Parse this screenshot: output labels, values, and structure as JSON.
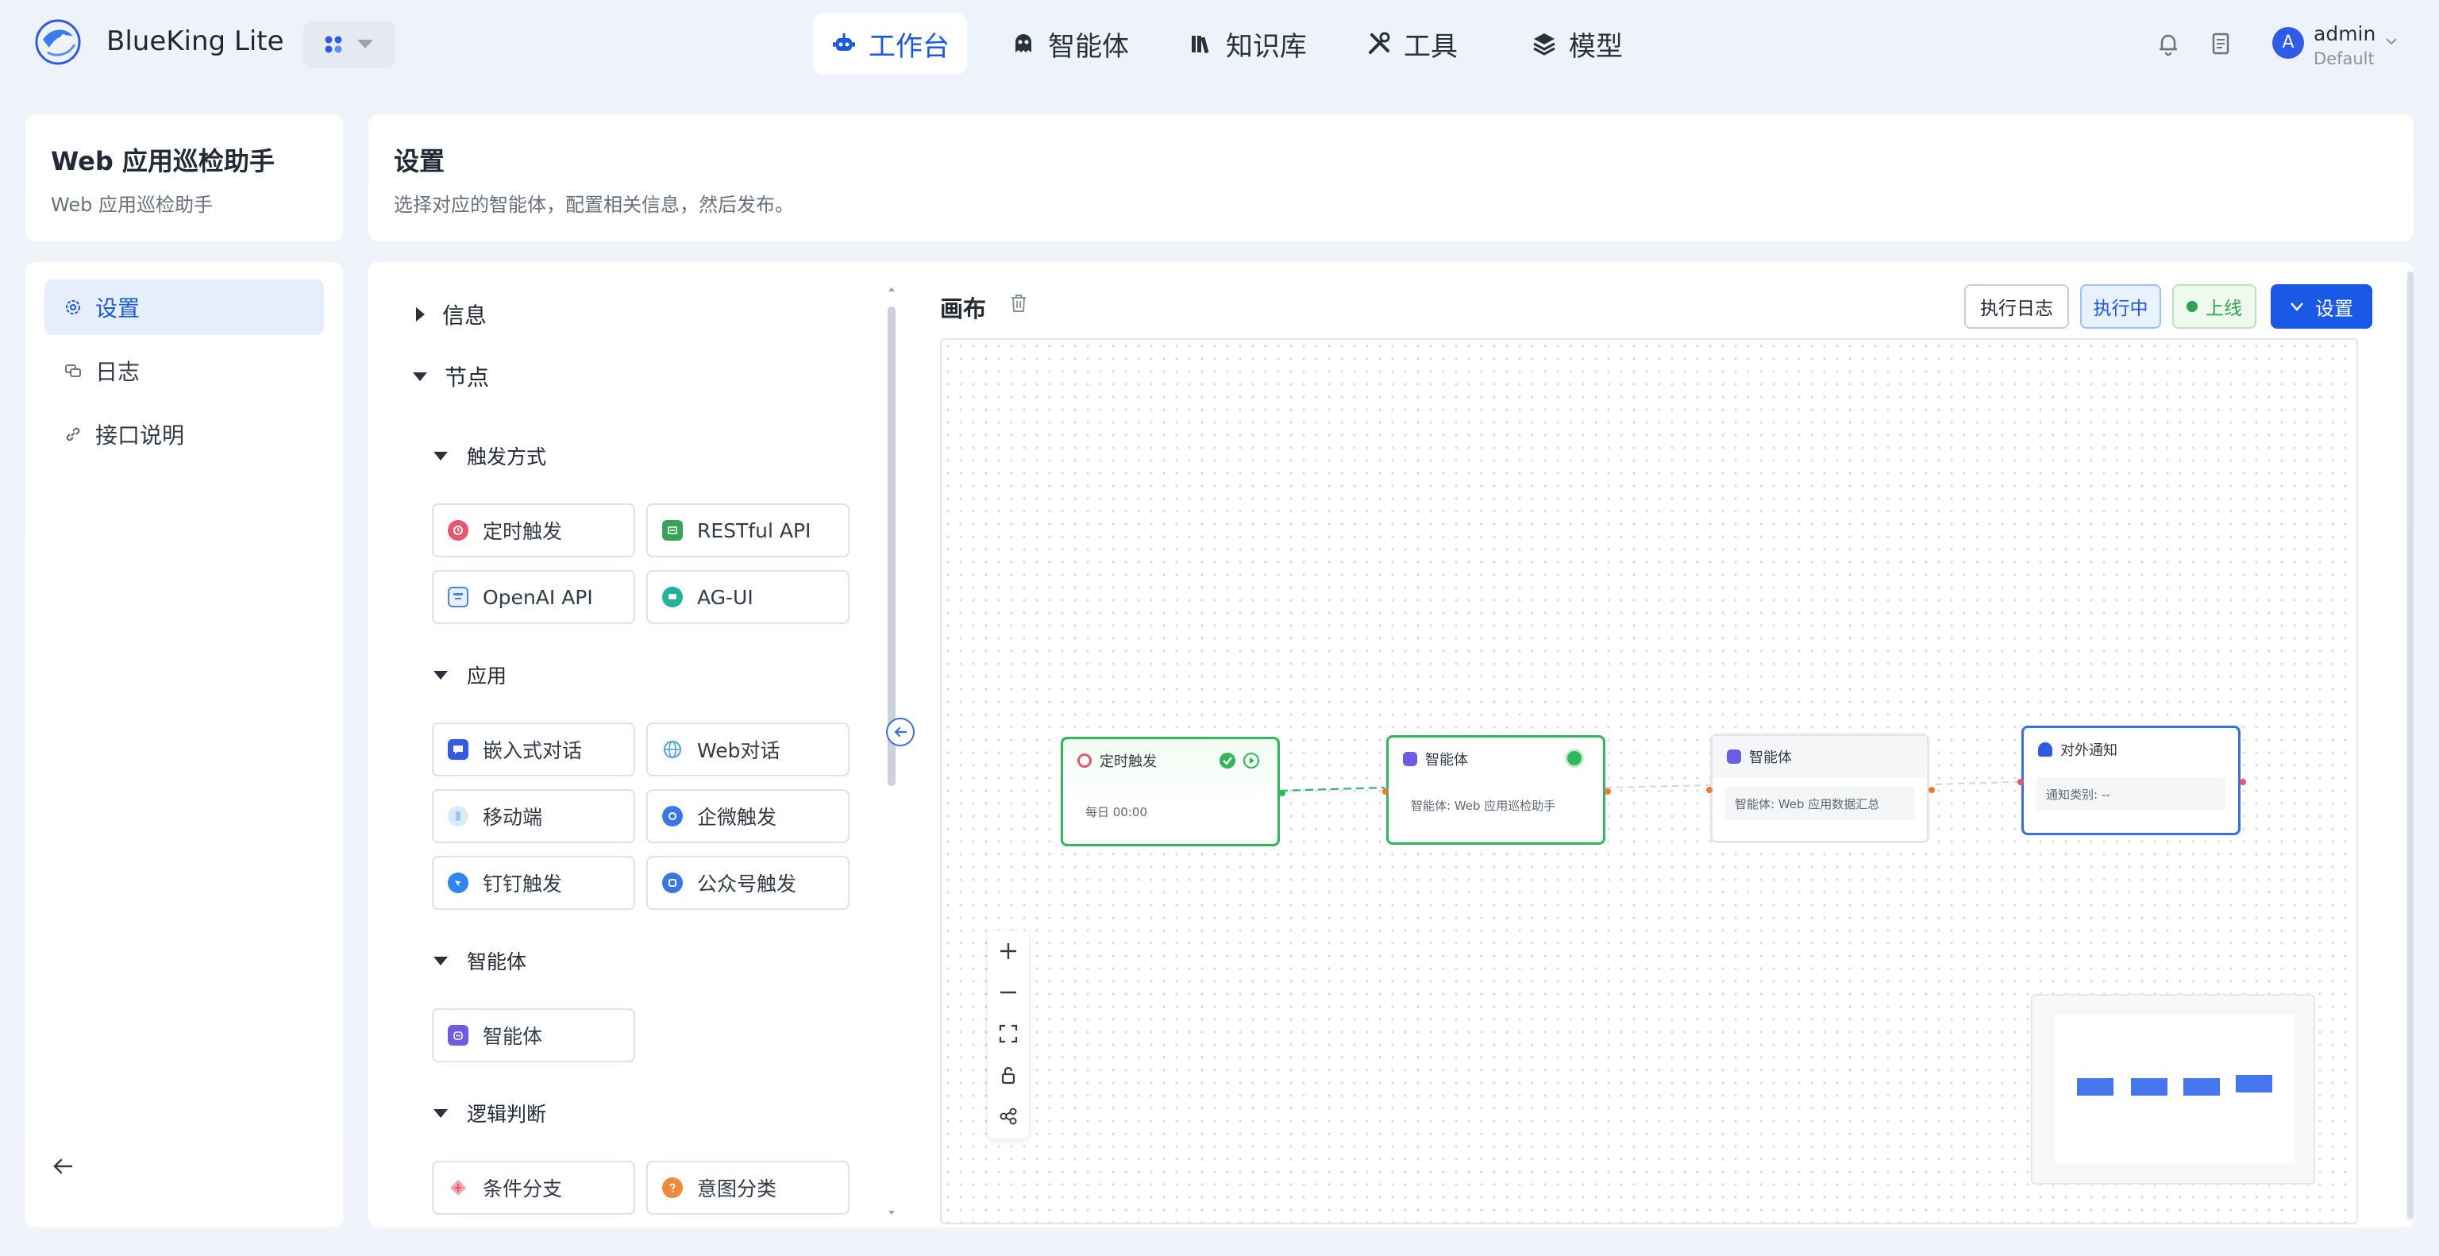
{
  "header": {
    "brand": "BlueKing Lite",
    "nav": [
      {
        "label": "工作台",
        "icon": "robot-icon",
        "active": true
      },
      {
        "label": "智能体",
        "icon": "agent-icon",
        "active": false
      },
      {
        "label": "知识库",
        "icon": "library-icon",
        "active": false
      },
      {
        "label": "工具",
        "icon": "tools-icon",
        "active": false
      },
      {
        "label": "模型",
        "icon": "layers-icon",
        "active": false
      }
    ],
    "user": {
      "avatar_letter": "A",
      "name": "admin",
      "space": "Default"
    }
  },
  "app": {
    "title": "Web 应用巡检助手",
    "subtitle": "Web 应用巡检助手"
  },
  "page": {
    "title": "设置",
    "subtitle": "选择对应的智能体，配置相关信息，然后发布。"
  },
  "sidebar": {
    "items": [
      {
        "label": "设置",
        "icon": "settings-icon",
        "active": true
      },
      {
        "label": "日志",
        "icon": "chat-log-icon",
        "active": false
      },
      {
        "label": "接口说明",
        "icon": "link-icon",
        "active": false
      }
    ]
  },
  "palette": {
    "sections": {
      "info": "信息",
      "nodes": "节点"
    },
    "groups": [
      {
        "label": "触发方式",
        "items": [
          {
            "label": "定时触发",
            "icon": "timer-icon",
            "color": "#e9566b"
          },
          {
            "label": "RESTful API",
            "icon": "api-icon",
            "color": "#3aa35a"
          },
          {
            "label": "OpenAI API",
            "icon": "openai-icon",
            "color": "#4a86e8"
          },
          {
            "label": "AG-UI",
            "icon": "agui-icon",
            "color": "#22b39a"
          }
        ]
      },
      {
        "label": "应用",
        "items": [
          {
            "label": "嵌入式对话",
            "icon": "embed-chat-icon",
            "color": "#2f5be6"
          },
          {
            "label": "Web对话",
            "icon": "globe-icon",
            "color": "#4aa3e0"
          },
          {
            "label": "移动端",
            "icon": "mobile-icon",
            "color": "#9cc8f0"
          },
          {
            "label": "企微触发",
            "icon": "wecom-icon",
            "color": "#3a77e6"
          },
          {
            "label": "钉钉触发",
            "icon": "dingtalk-icon",
            "color": "#2f86f0"
          },
          {
            "label": "公众号触发",
            "icon": "official-account-icon",
            "color": "#3a77e6"
          }
        ]
      },
      {
        "label": "智能体",
        "items": [
          {
            "label": "智能体",
            "icon": "agent-icon",
            "color": "#6b5be6"
          }
        ]
      },
      {
        "label": "逻辑判断",
        "items": [
          {
            "label": "条件分支",
            "icon": "branch-icon",
            "color": "#e9566b"
          },
          {
            "label": "意图分类",
            "icon": "intent-icon",
            "color": "#ef8a3c"
          }
        ]
      }
    ]
  },
  "canvas": {
    "title": "画布",
    "log_button": "执行日志",
    "running_tag": "执行中",
    "online_tag": "上线",
    "settings_button": "设置",
    "nodes": [
      {
        "title": "定时触发",
        "body": "每日 00:00",
        "border": "#2fb85a",
        "icon_color": "#e9566b"
      },
      {
        "title": "智能体",
        "body": "智能体: Web 应用巡检助手",
        "border": "#2fb85a",
        "icon_color": "#6b5be6"
      },
      {
        "title": "智能体",
        "body": "智能体: Web 应用数据汇总",
        "border": "#e3e6eb",
        "icon_color": "#6b5be6"
      },
      {
        "title": "对外通知",
        "body": "通知类别: --",
        "border": "#2f6ff0",
        "icon_color": "#2f5be6"
      }
    ]
  },
  "colors": {
    "accent": "#1a59e6",
    "success": "#2ea44f"
  }
}
